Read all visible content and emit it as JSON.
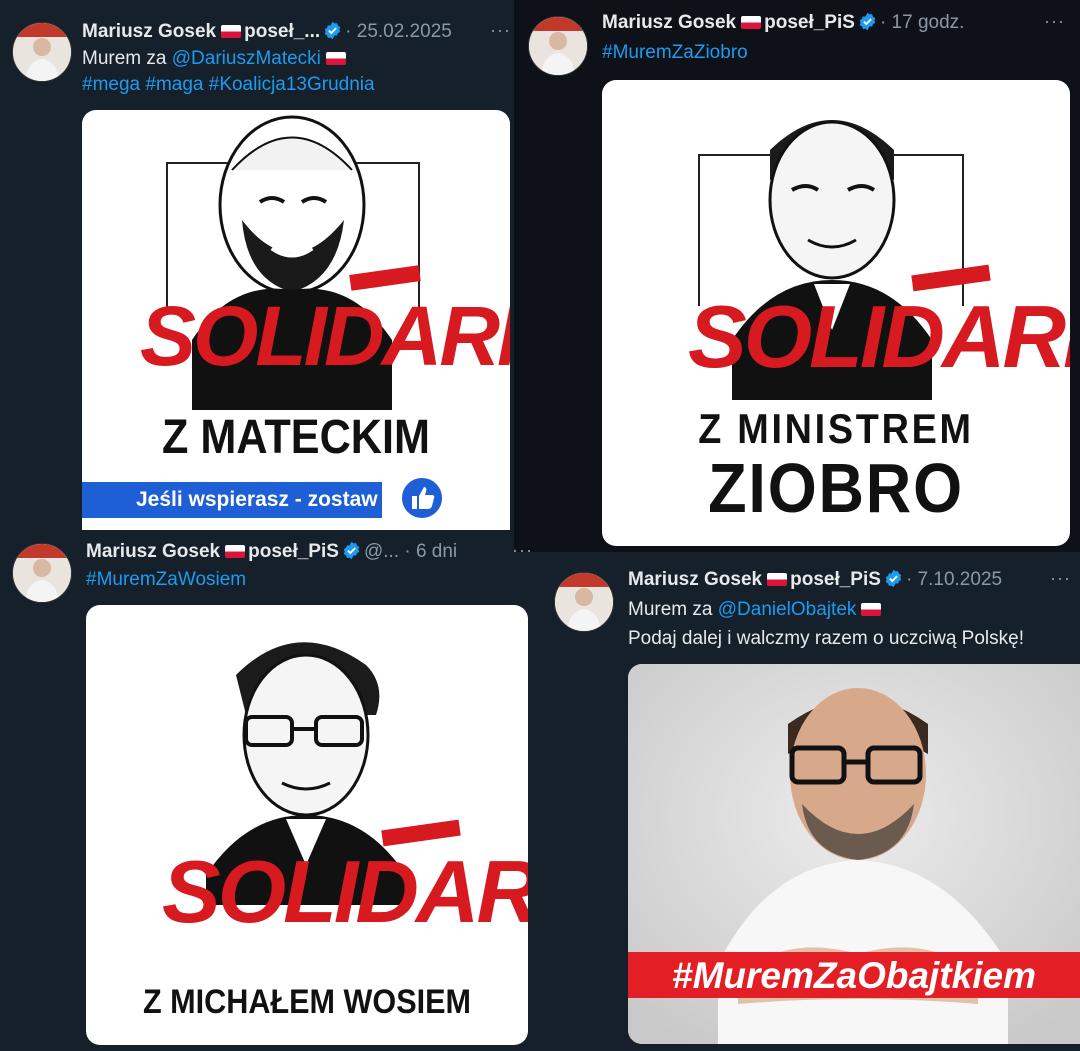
{
  "tweets": [
    {
      "author": "Mariusz Gosek",
      "handle": "poseł_...",
      "date": "25.02.2025",
      "line1_prefix": "Murem za",
      "line1_mention": "@DariuszMatecki",
      "hashtags": "#mega #maga #Koalicja13Grudnia",
      "graphic": {
        "slogan": "SOLIDARNI",
        "caption": "Z MATECKIM",
        "banner": "Jeśli wspierasz - zostaw"
      }
    },
    {
      "author": "Mariusz Gosek",
      "handle": "poseł_PiS",
      "date": "17 godz.",
      "hashtags": "#MuremZaZiobro",
      "graphic": {
        "slogan": "SOLIDARNI",
        "caption1": "Z MINISTREM",
        "caption2": "ZIOBRO"
      }
    },
    {
      "author": "Mariusz Gosek",
      "handle": "poseł_PiS",
      "handle_suffix": "@...",
      "date": "6 dni",
      "hashtags": "#MuremZaWosiem",
      "graphic": {
        "slogan": "SOLIDARNI",
        "caption": "Z MICHAŁEM WOSIEM"
      }
    },
    {
      "author": "Mariusz Gosek",
      "handle": "poseł_PiS",
      "date": "7.10.2025",
      "line1_prefix": "Murem za",
      "line1_mention": "@DanielObajtek",
      "line2": "Podaj dalej i walczmy razem o uczciwą Polskę!",
      "graphic": {
        "banner": "#MuremZaObajtkiem"
      }
    }
  ],
  "icons": {
    "more": "more-icon",
    "verified": "verified-badge-icon",
    "flag": "poland-flag-icon",
    "like": "thumbs-up-icon"
  },
  "colors": {
    "background": "#15202b",
    "link": "#1d9bf0",
    "verified": "#1d9bf0",
    "solidarity_red": "#d71920",
    "banner_blue": "#1f5fd6"
  }
}
